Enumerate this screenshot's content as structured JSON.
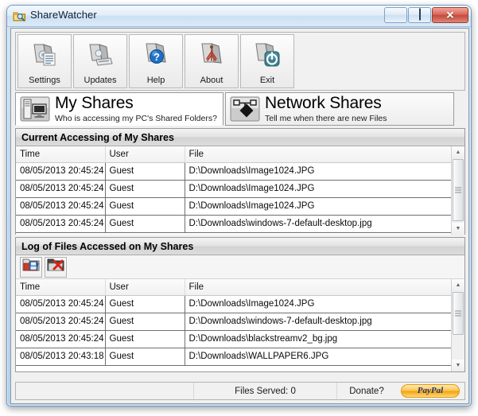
{
  "window": {
    "title": "ShareWatcher",
    "icon": "folder-magnifier-icon",
    "minimize_label": "Minimize",
    "maximize_label": "Maximize",
    "close_label": "Close"
  },
  "toolbar": {
    "buttons": [
      {
        "label": "Settings",
        "icon": "folder-settings-icon"
      },
      {
        "label": "Updates",
        "icon": "folder-update-icon"
      },
      {
        "label": "Help",
        "icon": "folder-help-icon"
      },
      {
        "label": "About",
        "icon": "folder-about-icon"
      },
      {
        "label": "Exit",
        "icon": "folder-power-icon"
      }
    ]
  },
  "tabs": [
    {
      "title": "My Shares",
      "subtitle": "Who is accessing my PC's Shared Folders?",
      "icon": "server-monitor-icon",
      "active": true
    },
    {
      "title": "Network Shares",
      "subtitle": "Tell me when there are new Files",
      "icon": "network-tag-icon",
      "active": false
    }
  ],
  "sections": [
    {
      "heading": "Current Accessing of My Shares",
      "columns": [
        "Time",
        "User",
        "File"
      ],
      "rows": [
        [
          "08/05/2013 20:45:24",
          "Guest",
          "D:\\Downloads\\Image1024.JPG"
        ],
        [
          "08/05/2013 20:45:24",
          "Guest",
          "D:\\Downloads\\Image1024.JPG"
        ],
        [
          "08/05/2013 20:45:24",
          "Guest",
          "D:\\Downloads\\Image1024.JPG"
        ],
        [
          "08/05/2013 20:45:24",
          "Guest",
          "D:\\Downloads\\windows-7-default-desktop.jpg"
        ]
      ]
    },
    {
      "heading": "Log of Files Accessed on My Shares",
      "columns": [
        "Time",
        "User",
        "File"
      ],
      "tools": [
        {
          "label": "Save Log",
          "icon": "folder-save-icon"
        },
        {
          "label": "Clear Log",
          "icon": "folder-delete-icon"
        }
      ],
      "rows": [
        [
          "08/05/2013 20:45:24",
          "Guest",
          "D:\\Downloads\\Image1024.JPG"
        ],
        [
          "08/05/2013 20:45:24",
          "Guest",
          "D:\\Downloads\\windows-7-default-desktop.jpg"
        ],
        [
          "08/05/2013 20:45:24",
          "Guest",
          "D:\\Downloads\\blackstreamv2_bg.jpg"
        ],
        [
          "08/05/2013 20:43:18",
          "Guest",
          "D:\\Downloads\\WALLPAPER6.JPG"
        ]
      ]
    }
  ],
  "statusbar": {
    "files_served": "Files Served: 0",
    "donate": "Donate?",
    "paypal": "PayPal"
  },
  "colors": {
    "accent": "#2b7bbd",
    "close_button": "#c24c3d",
    "paypal_gold": "#f2a40f",
    "window_frame": "#b6d0ea"
  }
}
